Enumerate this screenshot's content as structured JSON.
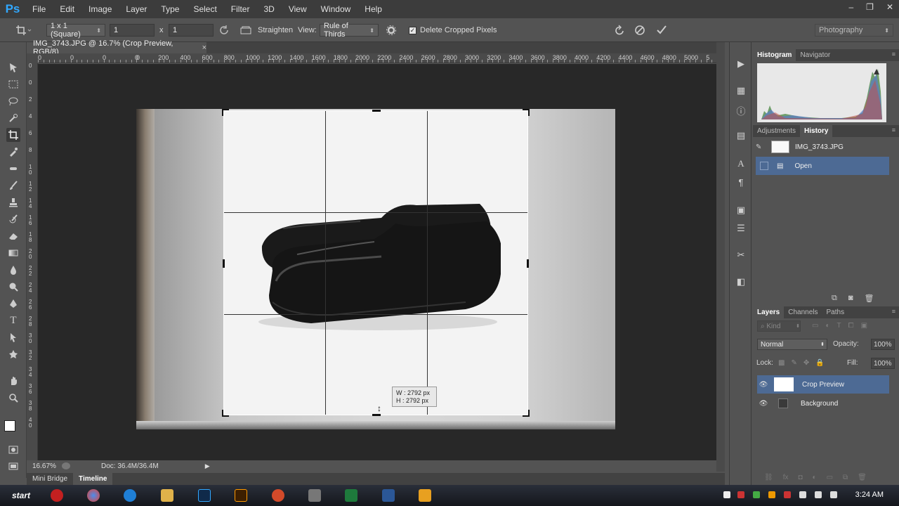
{
  "app": {
    "logo": "Ps"
  },
  "menu": [
    "File",
    "Edit",
    "Image",
    "Layer",
    "Type",
    "Select",
    "Filter",
    "3D",
    "View",
    "Window",
    "Help"
  ],
  "window_controls": {
    "minimize": "–",
    "restore": "❐",
    "close": "✕"
  },
  "options": {
    "ratio": "1 x 1 (Square)",
    "width_value": "1",
    "times": "x",
    "height_value": "1",
    "straighten_label": "Straighten",
    "view_label": "View:",
    "view_value": "Rule of Thirds",
    "delete_cropped_label": "Delete Cropped Pixels",
    "delete_cropped_checked": true,
    "workspace": "Photography"
  },
  "document": {
    "tab_title": "IMG_3743.JPG @ 16.7% (Crop Preview, RGB/8)",
    "close": "×"
  },
  "ruler_h": [
    "0",
    "200",
    "400",
    "600",
    "800",
    "1000",
    "1200",
    "1400",
    "1600",
    "1800",
    "2000",
    "2200",
    "2400",
    "2600",
    "2800",
    "3000",
    "3200",
    "3400",
    "3600",
    "3800",
    "4000",
    "4200",
    "4400",
    "4600",
    "4800",
    "5000",
    "5"
  ],
  "ruler_h_left": [
    "0",
    "0",
    "0",
    "0"
  ],
  "ruler_v": [
    "0",
    "0",
    "2",
    "4",
    "6",
    "8",
    "1 0",
    "1 2",
    "1 4",
    "1 6",
    "1 8",
    "2 0",
    "2 2",
    "2 4",
    "2 6",
    "2 8",
    "3 0",
    "3 2",
    "3 4",
    "3 6",
    "3 8",
    "4 0"
  ],
  "crop_tip": {
    "w": "W :  2792 px",
    "h": "H :  2792 px"
  },
  "status": {
    "zoom": "16.67%",
    "doc": "Doc: 36.4M/36.4M"
  },
  "bottom_tabs": [
    "Mini Bridge",
    "Timeline"
  ],
  "histogram_panel": {
    "tabs": [
      "Histogram",
      "Navigator"
    ]
  },
  "history_panel": {
    "tabs": [
      "Adjustments",
      "History"
    ],
    "snapshot": "IMG_3743.JPG",
    "items": [
      "Open"
    ]
  },
  "layers_panel": {
    "tabs": [
      "Layers",
      "Channels",
      "Paths"
    ],
    "filter": "Kind",
    "blend_mode": "Normal",
    "opacity_label": "Opacity:",
    "opacity_value": "100%",
    "lock_label": "Lock:",
    "fill_label": "Fill:",
    "fill_value": "100%",
    "layers": [
      "Crop Preview",
      "Background"
    ]
  },
  "taskbar": {
    "start": "start",
    "clock": "3:24 AM"
  },
  "colors": {
    "selection": "#4d6a94",
    "panel": "#535353",
    "dark": "#424242",
    "canvas": "#282828"
  }
}
